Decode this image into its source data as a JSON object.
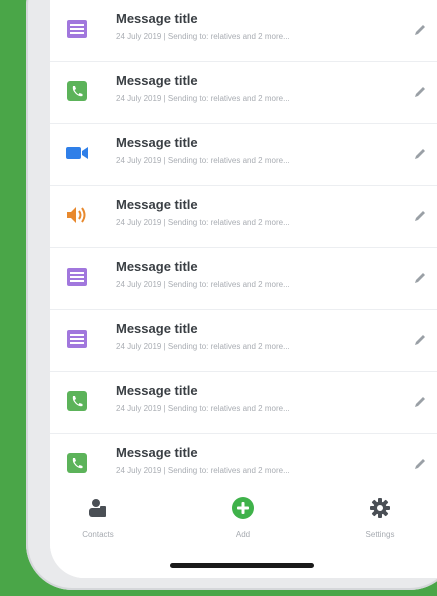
{
  "colors": {
    "background": "#4aa648",
    "purple": "#a177dd",
    "green": "#5cb35a",
    "blue": "#2f7fe8",
    "orange": "#e8892e",
    "add_button": "#3fb24a"
  },
  "messages": [
    {
      "title": "Message title",
      "subtitle": "24 July 2019  |  Sending to: relatives and 2 more...",
      "icon": "list-icon",
      "color": "purple"
    },
    {
      "title": "Message title",
      "subtitle": "24 July 2019  |  Sending to: relatives and 2 more...",
      "icon": "phone-icon",
      "color": "green"
    },
    {
      "title": "Message title",
      "subtitle": "24 July 2019  |  Sending to: relatives and 2 more...",
      "icon": "video-icon",
      "color": "blue"
    },
    {
      "title": "Message title",
      "subtitle": "24 July 2019  |  Sending to: relatives and 2 more...",
      "icon": "speaker-icon",
      "color": "orange"
    },
    {
      "title": "Message title",
      "subtitle": "24 July 2019  |  Sending to: relatives and 2 more...",
      "icon": "list-icon",
      "color": "purple"
    },
    {
      "title": "Message title",
      "subtitle": "24 July 2019  |  Sending to: relatives and 2 more...",
      "icon": "list-icon",
      "color": "purple"
    },
    {
      "title": "Message title",
      "subtitle": "24 July 2019  |  Sending to: relatives and 2 more...",
      "icon": "phone-icon",
      "color": "green"
    },
    {
      "title": "Message title",
      "subtitle": "24 July 2019  |  Sending to: relatives and 2 more...",
      "icon": "phone-icon",
      "color": "green"
    }
  ],
  "tabs": {
    "contacts": {
      "label": "Contacts",
      "icon": "contacts-icon"
    },
    "add": {
      "label": "Add",
      "icon": "add-circle-icon"
    },
    "settings": {
      "label": "Settings",
      "icon": "gear-icon"
    }
  }
}
